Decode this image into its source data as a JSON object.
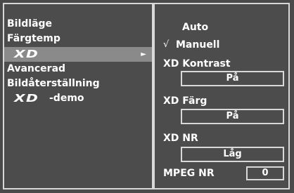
{
  "left_menu": {
    "items": [
      {
        "label": "Bildläge"
      },
      {
        "label": "Färgtemp"
      },
      {
        "label": "XD",
        "selected": true
      },
      {
        "label": "Avancerad"
      },
      {
        "label": "Bildåterställning"
      },
      {
        "label": "XD",
        "suffix": "-demo"
      }
    ]
  },
  "right_panel": {
    "modes": [
      {
        "label": "Auto",
        "checked": false
      },
      {
        "label": "Manuell",
        "checked": true
      }
    ],
    "check_mark": "√",
    "settings": [
      {
        "label": "XD Kontrast",
        "value": "På"
      },
      {
        "label": "XD Färg",
        "value": "På"
      },
      {
        "label": "XD NR",
        "value": "Låg"
      }
    ],
    "mpeg": {
      "label": "MPEG NR",
      "value": "0"
    }
  },
  "icons": {
    "arrow": "►",
    "submenu_arrow": "arrow-right-icon"
  },
  "colors": {
    "background": "#4c4c4c",
    "highlight": "#8a8a8a",
    "border": "#d8d8d8",
    "text": "#ffffff"
  }
}
